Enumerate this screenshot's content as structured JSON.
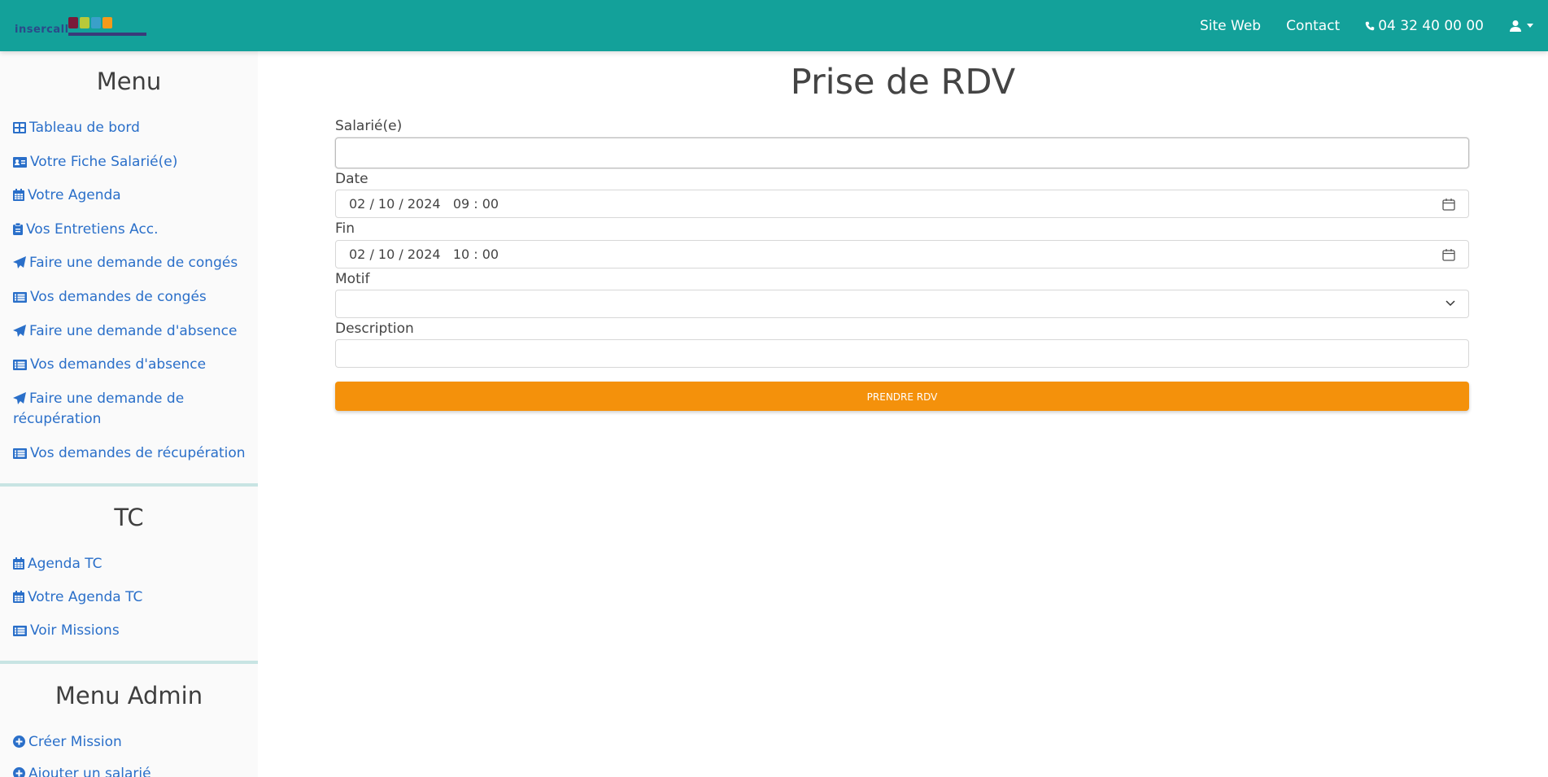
{
  "navbar": {
    "logo_text": "insercall",
    "links": {
      "site_web": "Site Web",
      "contact": "Contact",
      "phone": "04 32 40 00 00"
    }
  },
  "sidebar": {
    "menu_title": "Menu",
    "menu_items": [
      {
        "label": "Tableau de bord",
        "icon": "table-icon"
      },
      {
        "label": "Votre Fiche Salarié(e)",
        "icon": "id-card-icon"
      },
      {
        "label": "Votre Agenda",
        "icon": "calendar-icon"
      },
      {
        "label": "Vos Entretiens Acc.",
        "icon": "clipboard-icon"
      },
      {
        "label": "Faire une demande de congés",
        "icon": "paper-plane-icon"
      },
      {
        "label": "Vos demandes de congés",
        "icon": "list-icon"
      },
      {
        "label": "Faire une demande d'absence",
        "icon": "paper-plane-icon"
      },
      {
        "label": "Vos demandes d'absence",
        "icon": "list-icon"
      },
      {
        "label": "Faire une demande de récupération",
        "icon": "paper-plane-icon"
      },
      {
        "label": "Vos demandes de récupération",
        "icon": "list-icon"
      }
    ],
    "tc_title": "TC",
    "tc_items": [
      {
        "label": "Agenda TC",
        "icon": "calendar-icon"
      },
      {
        "label": "Votre Agenda TC",
        "icon": "calendar-icon"
      },
      {
        "label": "Voir Missions",
        "icon": "list-icon"
      }
    ],
    "admin_title": "Menu Admin",
    "admin_items": [
      {
        "label": "Créer Mission",
        "icon": "plus-circle-icon"
      },
      {
        "label": "Ajouter un salarié",
        "icon": "plus-circle-icon"
      }
    ]
  },
  "main": {
    "title": "Prise de RDV",
    "fields": {
      "salarie_label": "Salarié(e)",
      "salarie_value": "",
      "date_label": "Date",
      "date_value": "02 / 10 / 2024   09 : 00",
      "fin_label": "Fin",
      "fin_value": "02 / 10 / 2024   10 : 00",
      "motif_label": "Motif",
      "motif_value": "",
      "description_label": "Description",
      "description_value": ""
    },
    "submit_label": "PRENDRE RDV"
  },
  "colors": {
    "navbar": "#13a19a",
    "link": "#2a6fc9",
    "button": "#f4910b",
    "divider": "#c8e4e3"
  }
}
